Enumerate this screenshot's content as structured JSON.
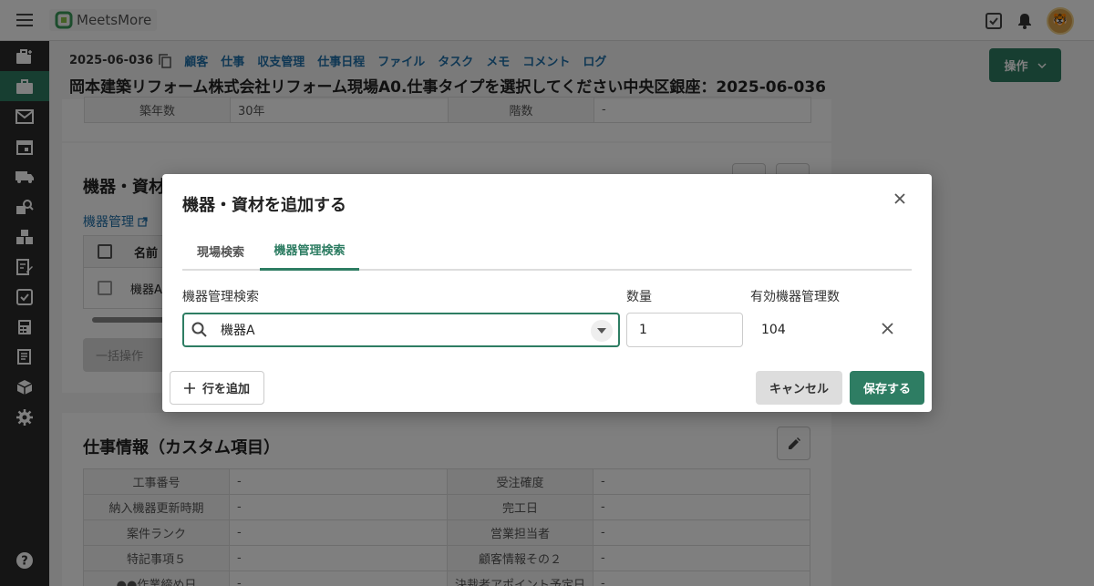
{
  "topbar": {
    "logo_text": "MeetsMore"
  },
  "breadcrumb": {
    "job_id": "2025-06-036",
    "links": [
      "顧客",
      "仕事",
      "収支管理",
      "仕事日程",
      "ファイル",
      "タスク",
      "メモ",
      "コメント",
      "ログ"
    ]
  },
  "page_title": "岡本建築リフォーム株式会社リフォーム現場A0.仕事タイプを選択してください中央区銀座：2025-06-036",
  "operation_button": "操作",
  "building_info": {
    "age_label": "築年数",
    "age_value": "30年",
    "floors_label": "階数",
    "floors_value": "-"
  },
  "equipment_section": {
    "title": "機器・資材",
    "link": "機器管理",
    "col_name": "名前",
    "row_name": "機器A",
    "bulk_button": "一括操作"
  },
  "custom_section": {
    "title": "仕事情報（カスタム項目）",
    "rows": [
      {
        "k1": "工事番号",
        "v1": "-",
        "k2": "受注確度",
        "v2": "-"
      },
      {
        "k1": "納入機器更新時期",
        "v1": "-",
        "k2": "完工日",
        "v2": "-"
      },
      {
        "k1": "案件ランク",
        "v1": "-",
        "k2": "営業担当者",
        "v2": "-"
      },
      {
        "k1": "特記事項５",
        "v1": "-",
        "k2": "顧客情報その２",
        "v2": "-"
      },
      {
        "k1": "●●作業締め日",
        "v1": "-",
        "k2": "決裁者アポイント予定日",
        "v2": "-"
      }
    ]
  },
  "modal": {
    "title": "機器・資材を追加する",
    "tabs": [
      "現場検索",
      "機器管理検索"
    ],
    "active_tab": 1,
    "search_label": "機器管理検索",
    "search_value": "機器A",
    "quantity_label": "数量",
    "quantity_value": "1",
    "count_label": "有効機器管理数",
    "count_value": "104",
    "add_row_button": "行を追加",
    "cancel_button": "キャンセル",
    "save_button": "保存する"
  },
  "colors": {
    "brand": "#2e7d63",
    "sidebar": "#2b2b2b",
    "link": "#1f6fa8"
  }
}
